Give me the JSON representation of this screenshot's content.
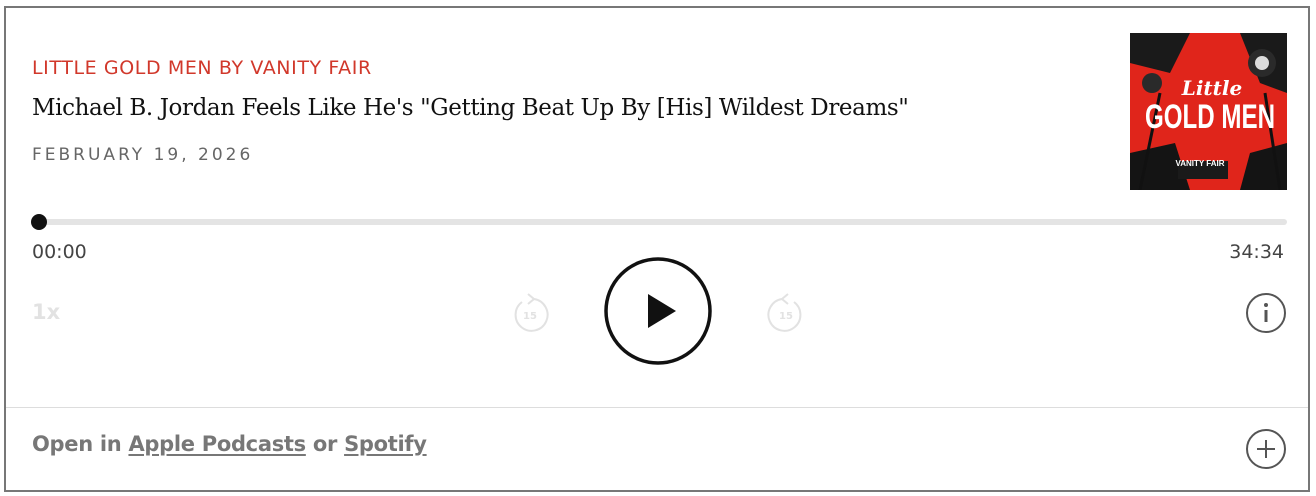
{
  "podcast": {
    "show_name": "LITTLE GOLD MEN BY VANITY FAIR",
    "episode_title": "Michael B. Jordan Feels Like He's \"Getting Beat Up By [His] Wildest Dreams\"",
    "date": "FEBRUARY 19, 2026",
    "artwork": {
      "title_line1": "Little",
      "title_line2": "GOLD MEN",
      "badge": "VANITY FAIR"
    }
  },
  "player": {
    "elapsed": "00:00",
    "duration": "34:34",
    "progress": 0,
    "speed": "1x",
    "rewind_seconds": "15",
    "forward_seconds": "15"
  },
  "footer": {
    "open_in_prefix": "Open in",
    "apple_label": "Apple Podcasts",
    "or_label": "or",
    "spotify_label": "Spotify"
  },
  "colors": {
    "accent": "#d1382b",
    "text": "#111111",
    "muted": "#666666"
  },
  "icons": {
    "play": "play-icon",
    "rewind": "rewind-15-icon",
    "forward": "forward-15-icon",
    "info": "info-icon",
    "add": "plus-icon"
  }
}
